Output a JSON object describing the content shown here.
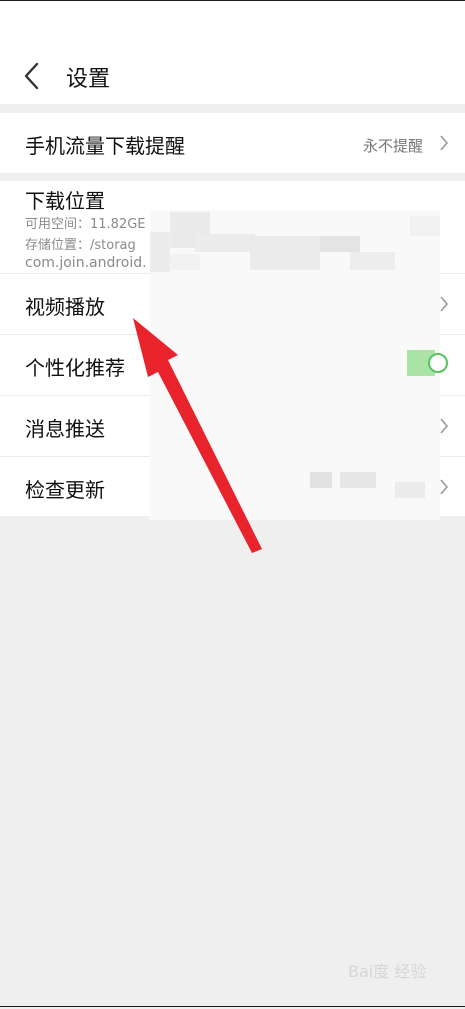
{
  "header": {
    "title": "设置"
  },
  "rows": {
    "mobile_data_alert": {
      "label": "手机流量下载提醒",
      "value": "永不提醒"
    },
    "download_location": {
      "label": "下载位置",
      "free_space": "可用空间：11.82GE",
      "storage_path": "存储位置：/storag",
      "package": "com.join.android."
    },
    "video_playback": {
      "label": "视频播放"
    },
    "personalized": {
      "label": "个性化推荐"
    },
    "push": {
      "label": "消息推送"
    },
    "update": {
      "label": "检查更新"
    }
  },
  "watermark": "Bai度 经验",
  "colors": {
    "arrow": "#e8232b",
    "toggle_on": "#57c45d",
    "background": "#efefef"
  }
}
